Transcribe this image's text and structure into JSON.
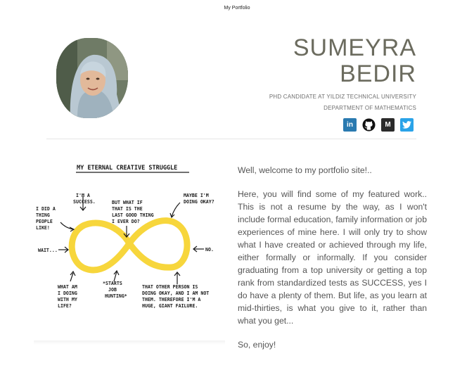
{
  "page": {
    "title": "My Portfolio"
  },
  "header": {
    "first_name": "SUMEYRA",
    "last_name": "BEDIR",
    "subtitle_line1": "PHD CANDIDATE AT YILDIZ TECHNICAL UNIVERSITY",
    "subtitle_line2": "DEPARTMENT OF MATHEMATICS"
  },
  "social": [
    {
      "name": "linkedin",
      "label": "in",
      "color": "#2a7ab0"
    },
    {
      "name": "github",
      "label": "",
      "color": "#111111"
    },
    {
      "name": "medium",
      "label": "M",
      "color": "#2b2b2b"
    },
    {
      "name": "twitter",
      "label": "",
      "color": "#2aa3e8"
    }
  ],
  "illustration": {
    "title": "MY ETERNAL CREATIVE STRUGGLE",
    "labels": {
      "i_did": [
        "I DID A",
        "THING",
        "PEOPLE",
        "LIKE!"
      ],
      "success": [
        "I'M A",
        "SUCCESS."
      ],
      "what_if": [
        "BUT WHAT IF",
        "THAT IS THE",
        "LAST GOOD THING",
        "I EVER DO?"
      ],
      "okay": [
        "MAYBE I'M",
        "DOING OKAY?"
      ],
      "wait": "WAIT...",
      "no": "NO.",
      "what_am": [
        "WHAT AM",
        "I DOING",
        "WITH MY",
        "LIFE?"
      ],
      "job": [
        "*STARTS",
        "JOB",
        "HUNTING*"
      ],
      "other": [
        "THAT OTHER PERSON IS",
        "DOING OKAY, AND I AM NOT",
        "THEM. THEREFORE I'M A",
        "HUGE, GIANT FAILURE."
      ]
    },
    "loop_color": "#f7d63c"
  },
  "content": {
    "greeting": "Well, welcome to my portfolio site!..",
    "body": "Here, you will find some of my featured work.. This is not a resume by the way, as I won't include formal education, family information or job experiences of mine here. I will only try to show what I have created or achieved through my life, either formally or informally. If you consider graduating from a top university or getting a top rank from standardized tests as SUCCESS, yes I do have a plenty of them. But life, as you learn at mid-thirties, is what you give to it, rather than what you get...",
    "closing": "So, enjoy!"
  }
}
